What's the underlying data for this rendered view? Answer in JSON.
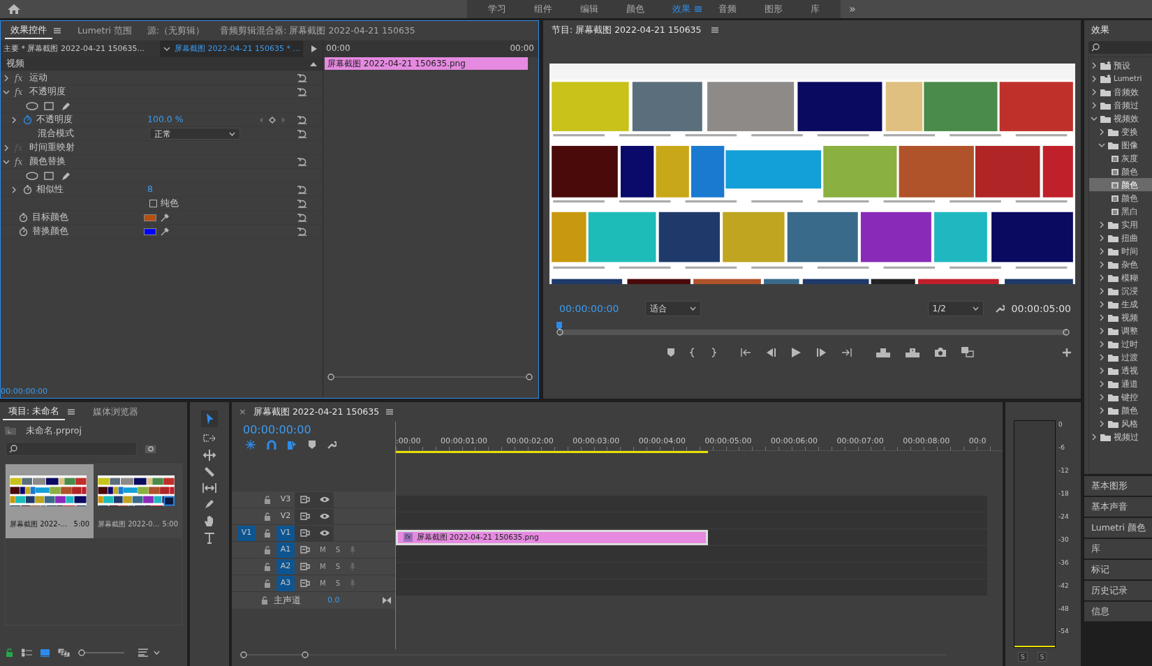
{
  "workspace_tabs": [
    {
      "label": "学习",
      "selected": false
    },
    {
      "label": "组件",
      "selected": false
    },
    {
      "label": "编辑",
      "selected": false
    },
    {
      "label": "颜色",
      "selected": false
    },
    {
      "label": "效果",
      "selected": true
    },
    {
      "label": "音频",
      "selected": false
    },
    {
      "label": "图形",
      "selected": false
    },
    {
      "label": "库",
      "selected": false
    }
  ],
  "workspace_overflow": "»",
  "effect_controls": {
    "tabs": [
      {
        "label": "效果控件",
        "selected": true
      },
      {
        "label": "Lumetri 范围",
        "selected": false
      },
      {
        "label": "源:（无剪辑）",
        "selected": false
      },
      {
        "label": "音频剪辑混合器: 屏幕截图 2022-04-21 150635",
        "selected": false
      }
    ],
    "master_clip": "主要 * 屏幕截图 2022-04-21 150635...",
    "sequence_clip": "屏幕截图 2022-04-21 150635 * ...",
    "ruler_start": "00:00",
    "ruler_end": "00:00",
    "clip_label": "屏幕截图 2022-04-21  150635.png",
    "section": "视频",
    "rows": [
      {
        "kind": "effect",
        "badge": "fx",
        "label": "运动",
        "expanded": false,
        "enabled": true
      },
      {
        "kind": "effect",
        "badge": "fx",
        "label": "不透明度",
        "expanded": true,
        "enabled": true
      },
      {
        "kind": "masks"
      },
      {
        "kind": "param",
        "label": "不透明度",
        "value": "100.0 %",
        "animated": true
      },
      {
        "kind": "dropdown",
        "label": "混合模式",
        "value": "正常"
      },
      {
        "kind": "effect",
        "badge": "fx",
        "label": "时间重映射",
        "expanded": false,
        "enabled": false
      },
      {
        "kind": "effect",
        "badge": "fx",
        "label": "颜色替换",
        "expanded": true,
        "enabled": true
      },
      {
        "kind": "masks"
      },
      {
        "kind": "param",
        "label": "相似性",
        "value": "8",
        "animated": false
      },
      {
        "kind": "checkbox",
        "label": "纯色",
        "checked": false
      },
      {
        "kind": "color",
        "label": "目标颜色",
        "color": "#b5500f"
      },
      {
        "kind": "color",
        "label": "替换颜色",
        "color": "#0000ff"
      }
    ],
    "timecode": "00:00:00:00"
  },
  "program": {
    "title": "节目: 屏幕截图 2022-04-21 150635",
    "timecode": "00:00:00:00",
    "zoom": "适合",
    "resolution": "1/2",
    "duration": "00:00:05:00"
  },
  "project": {
    "zoom_slider": {
      "level": 0
    },
    "tabs": [
      {
        "label": "项目: 未命名",
        "selected": true
      },
      {
        "label": "媒体浏览器",
        "selected": false
      }
    ],
    "file": "未命名.prproj",
    "items": [
      {
        "name": "屏幕截图 2022-…",
        "duration": "5:00",
        "selected": true,
        "kind": "still"
      },
      {
        "name": "屏幕截图 2022-0…",
        "duration": "5:00",
        "selected": false,
        "kind": "sequence"
      }
    ]
  },
  "timeline": {
    "close": "×",
    "title": "屏幕截图 2022-04-21 150635",
    "timecode": "00:00:00:00",
    "ruler": [
      ":00:00",
      "00:00:01:00",
      "00:00:02:00",
      "00:00:03:00",
      "00:00:04:00",
      "00:00:05:00",
      "00:00:06:00",
      "00:00:07:00",
      "00:00:08:00",
      "00:0"
    ],
    "tracks": [
      {
        "kind": "video",
        "label": "V3",
        "targeted": false
      },
      {
        "kind": "video",
        "label": "V2",
        "targeted": false
      },
      {
        "kind": "video",
        "label": "V1",
        "targeted": true,
        "source": "V1",
        "clip": {
          "badge": "fx",
          "label": "屏幕截图 2022-04-21  150635.png"
        }
      },
      {
        "kind": "audio",
        "label": "A1",
        "targeted": true,
        "mute": "M",
        "solo": "S"
      },
      {
        "kind": "audio",
        "label": "A2",
        "targeted": true,
        "mute": "M",
        "solo": "S"
      },
      {
        "kind": "audio",
        "label": "A3",
        "targeted": true,
        "mute": "M",
        "solo": "S"
      }
    ],
    "master": {
      "label": "主声道",
      "value": "0.0"
    }
  },
  "audio_meter": {
    "scale": [
      "0",
      "-6",
      "-12",
      "-18",
      "-24",
      "-30",
      "-36",
      "-42",
      "-48",
      "-54"
    ],
    "solo_buttons": [
      "S",
      "S"
    ]
  },
  "effects_panel": {
    "title": "效果",
    "tree": [
      {
        "kind": "preset_folder",
        "label": "预设",
        "expanded": false
      },
      {
        "kind": "preset_folder",
        "label": "Lumetri",
        "expanded": false
      },
      {
        "kind": "folder",
        "label": "音频效",
        "expanded": false
      },
      {
        "kind": "folder",
        "label": "音频过",
        "expanded": false
      },
      {
        "kind": "folder",
        "label": "视频效",
        "expanded": true,
        "children": [
          {
            "kind": "folder",
            "label": "变换",
            "expanded": false
          },
          {
            "kind": "folder",
            "label": "图像",
            "expanded": true,
            "children": [
              {
                "kind": "effect",
                "label": "灰度",
                "selected": false
              },
              {
                "kind": "effect",
                "label": "颜色",
                "selected": false
              },
              {
                "kind": "effect",
                "label": "颜色",
                "selected": true
              },
              {
                "kind": "effect",
                "label": "颜色",
                "selected": false
              },
              {
                "kind": "effect",
                "label": "黑白",
                "selected": false
              }
            ]
          },
          {
            "kind": "folder",
            "label": "实用",
            "expanded": false
          },
          {
            "kind": "folder",
            "label": "扭曲",
            "expanded": false
          },
          {
            "kind": "folder",
            "label": "时间",
            "expanded": false
          },
          {
            "kind": "folder",
            "label": "杂色",
            "expanded": false
          },
          {
            "kind": "folder",
            "label": "模糊",
            "expanded": false
          },
          {
            "kind": "folder",
            "label": "沉浸",
            "expanded": false
          },
          {
            "kind": "folder",
            "label": "生成",
            "expanded": false
          },
          {
            "kind": "folder",
            "label": "视频",
            "expanded": false
          },
          {
            "kind": "folder",
            "label": "调整",
            "expanded": false
          },
          {
            "kind": "folder",
            "label": "过时",
            "expanded": false
          },
          {
            "kind": "folder",
            "label": "过渡",
            "expanded": false
          },
          {
            "kind": "folder",
            "label": "透视",
            "expanded": false
          },
          {
            "kind": "folder",
            "label": "通道",
            "expanded": false
          },
          {
            "kind": "folder",
            "label": "键控",
            "expanded": false
          },
          {
            "kind": "folder",
            "label": "颜色",
            "expanded": false
          },
          {
            "kind": "folder",
            "label": "风格",
            "expanded": false
          }
        ]
      },
      {
        "kind": "folder",
        "label": "视频过",
        "expanded": false
      }
    ]
  },
  "side_panels": [
    "基本图形",
    "基本声音",
    "Lumetri 颜色",
    "库",
    "标记",
    "历史记录",
    "信息"
  ]
}
